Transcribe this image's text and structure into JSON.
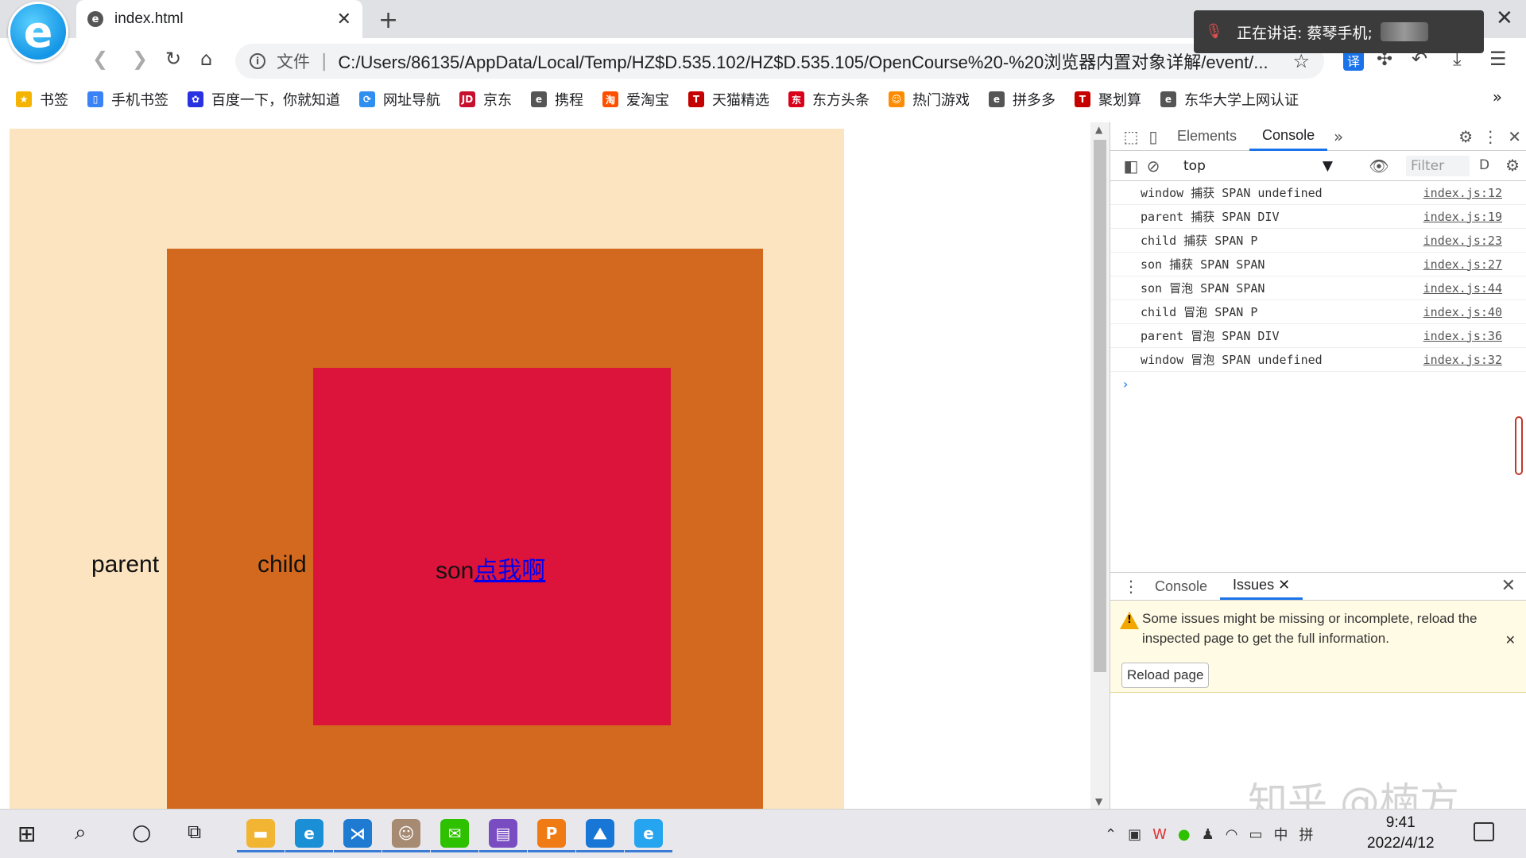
{
  "browser": {
    "tab_title": "index.html",
    "new_tab": "+",
    "close_glyph": "✕",
    "notification": "正在讲话: 蔡琴手机;",
    "address": {
      "file_label": "文件",
      "separator": "|",
      "url": "C:/Users/86135/AppData/Local/Temp/HZ$D.535.102/HZ$D.535.105/OpenCourse%20-%20浏览器内置对象详解/event/..."
    },
    "translate_label": "译",
    "more_bookmarks": "»"
  },
  "bookmarks": [
    {
      "label": "书签",
      "icon": "star-icon",
      "color": "#f4b400",
      "glyph": "★"
    },
    {
      "label": "手机书签",
      "icon": "phone-bookmark-icon",
      "color": "#3b82f6",
      "glyph": "▯"
    },
    {
      "label": "百度一下，你就知道",
      "icon": "baidu-icon",
      "color": "#2932e1",
      "glyph": "✿"
    },
    {
      "label": "网址导航",
      "icon": "nav-icon",
      "color": "#2f8ff0",
      "glyph": "⟳"
    },
    {
      "label": "京东",
      "icon": "jd-icon",
      "color": "#c8102e",
      "glyph": "JD"
    },
    {
      "label": "携程",
      "icon": "ctrip-icon",
      "color": "#555555",
      "glyph": "e"
    },
    {
      "label": "爱淘宝",
      "icon": "taobao-icon",
      "color": "#ff5000",
      "glyph": "淘"
    },
    {
      "label": "天猫精选",
      "icon": "tmall-icon",
      "color": "#c40000",
      "glyph": "T"
    },
    {
      "label": "东方头条",
      "icon": "dongfang-icon",
      "color": "#d9001b",
      "glyph": "东"
    },
    {
      "label": "热门游戏",
      "icon": "game-icon",
      "color": "#ff8c00",
      "glyph": "☺"
    },
    {
      "label": "拼多多",
      "icon": "pdd-icon",
      "color": "#555555",
      "glyph": "e"
    },
    {
      "label": "聚划算",
      "icon": "juhuasuan-icon",
      "color": "#c40000",
      "glyph": "T"
    },
    {
      "label": "东华大学上网认证",
      "icon": "dhu-icon",
      "color": "#555555",
      "glyph": "e"
    }
  ],
  "page": {
    "parent_label": "parent",
    "child_label": "child",
    "son_label": "son",
    "son_link": "点我啊",
    "colors": {
      "parent": "#fde4c0",
      "child": "#d2691e",
      "son": "#dc143c"
    }
  },
  "devtools": {
    "tabs": [
      "Elements",
      "Console"
    ],
    "active_tab": "Console",
    "more_tabs": "»",
    "context": "top",
    "filter_placeholder": "Filter",
    "filter_suffix": "D",
    "logs": [
      {
        "text": "window 捕获 SPAN undefined",
        "source": "index.js:12"
      },
      {
        "text": "parent 捕获 SPAN DIV",
        "source": "index.js:19"
      },
      {
        "text": "child 捕获 SPAN P",
        "source": "index.js:23"
      },
      {
        "text": "son 捕获 SPAN SPAN",
        "source": "index.js:27"
      },
      {
        "text": "son 冒泡 SPAN SPAN",
        "source": "index.js:44"
      },
      {
        "text": "child 冒泡 SPAN P",
        "source": "index.js:40"
      },
      {
        "text": "parent 冒泡 SPAN DIV",
        "source": "index.js:36"
      },
      {
        "text": "window 冒泡 SPAN undefined",
        "source": "index.js:32"
      }
    ],
    "prompt": "›",
    "drawer": {
      "tabs": [
        "Console",
        "Issues"
      ],
      "active_tab": "Issues",
      "issues_message": "Some issues might be missing or incomplete, reload the inspected page to get the full information.",
      "reload_label": "Reload page"
    }
  },
  "watermark": "知乎 @楠方",
  "taskbar": {
    "apps": [
      {
        "name": "file-explorer-icon",
        "color": "#f2b533",
        "glyph": "▬",
        "running": true
      },
      {
        "name": "edge-icon",
        "color": "#1a8fd6",
        "glyph": "e",
        "running": true
      },
      {
        "name": "vscode-icon",
        "color": "#1f7ad1",
        "glyph": "⋊",
        "running": true
      },
      {
        "name": "avatar-app-icon",
        "color": "#a68a72",
        "glyph": "☺",
        "running": true
      },
      {
        "name": "wechat-icon",
        "color": "#2dc100",
        "glyph": "✉",
        "running": true
      },
      {
        "name": "archive-icon",
        "color": "#7a4cc2",
        "glyph": "▤",
        "running": true
      },
      {
        "name": "wps-icon",
        "color": "#f07b15",
        "glyph": "P",
        "running": true
      },
      {
        "name": "photos-icon",
        "color": "#1877d6",
        "glyph": "⛰",
        "running": true
      },
      {
        "name": "browser-icon",
        "color": "#25a4ef",
        "glyph": "e",
        "running": true
      }
    ],
    "tray": {
      "ime_lang": "中",
      "ime_mode": "拼"
    },
    "time": "9:41",
    "date": "2022/4/12"
  }
}
